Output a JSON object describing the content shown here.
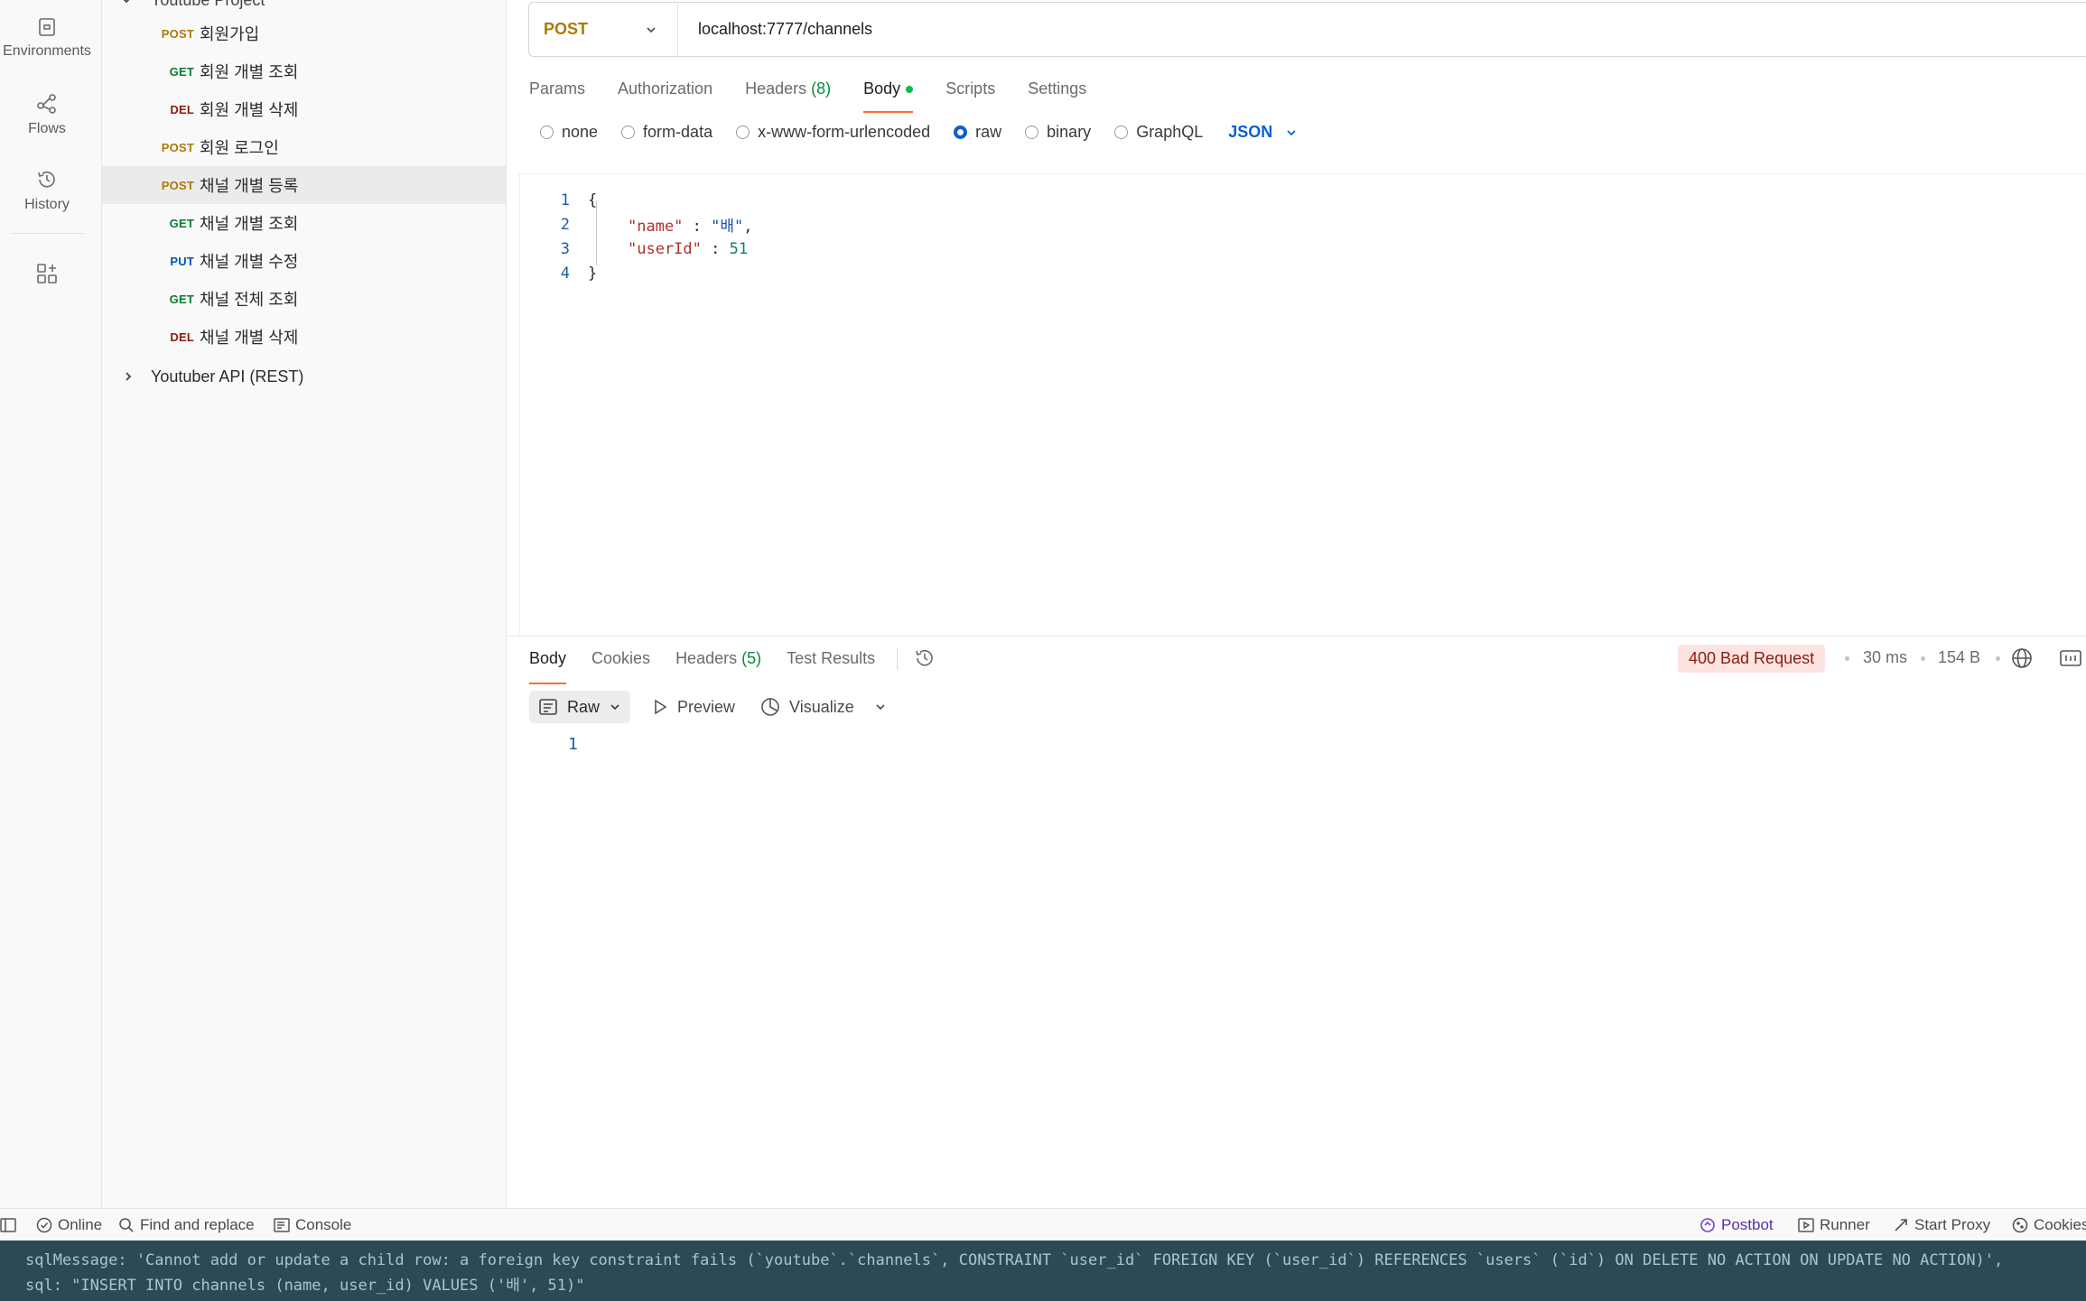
{
  "rail": {
    "items": [
      {
        "label": "Environments",
        "icon": "environments-icon"
      },
      {
        "label": "Flows",
        "icon": "flows-icon"
      },
      {
        "label": "History",
        "icon": "history-icon"
      }
    ]
  },
  "tree": {
    "parent_collection": "Youtube Project",
    "requests": [
      {
        "method": "POST",
        "name": "회원가입"
      },
      {
        "method": "GET",
        "name": "회원 개별 조회"
      },
      {
        "method": "DEL",
        "name": "회원 개별 삭제"
      },
      {
        "method": "POST",
        "name": "회원 로그인"
      },
      {
        "method": "POST",
        "name": "채널 개별 등록",
        "selected": true
      },
      {
        "method": "GET",
        "name": "채널 개별 조회"
      },
      {
        "method": "PUT",
        "name": "채널 개별 수정"
      },
      {
        "method": "GET",
        "name": "채널 전체 조회"
      },
      {
        "method": "DEL",
        "name": "채널 개별 삭제"
      }
    ],
    "collapsed_collection": "Youtuber API (REST)"
  },
  "request": {
    "method": "POST",
    "url": "localhost:7777/channels",
    "tabs": {
      "params": "Params",
      "authorization": "Authorization",
      "headers": "Headers",
      "headers_count": "(8)",
      "body": "Body",
      "scripts": "Scripts",
      "settings": "Settings"
    },
    "body_types": [
      "none",
      "form-data",
      "x-www-form-urlencoded",
      "raw",
      "binary",
      "GraphQL"
    ],
    "body_type_selected": "raw",
    "language": "JSON",
    "code_lines": {
      "l1": "1",
      "l2": "2",
      "l3": "3",
      "l4": "4",
      "open": "{",
      "key1": "\"name\"",
      "val1": "\"배\"",
      "key2": "\"userId\"",
      "val2": "51",
      "close": "}"
    }
  },
  "response": {
    "tabs": {
      "body": "Body",
      "cookies": "Cookies",
      "headers": "Headers",
      "headers_count": "(5)",
      "test_results": "Test Results"
    },
    "status": "400 Bad Request",
    "time": "30 ms",
    "size": "154 B",
    "format": "Raw",
    "preview": "Preview",
    "visualize": "Visualize",
    "line1": "1"
  },
  "statusbar": {
    "online": "Online",
    "find_replace": "Find and replace",
    "console": "Console",
    "postbot": "Postbot",
    "runner": "Runner",
    "start_proxy": "Start Proxy",
    "cookies": "Cookies"
  },
  "terminal": {
    "line1": "sqlMessage: 'Cannot add or update a child row: a foreign key constraint fails (`youtube`.`channels`, CONSTRAINT `user_id` FOREIGN KEY (`user_id`) REFERENCES `users` (`id`) ON DELETE NO ACTION ON UPDATE NO ACTION)',",
    "line2": "sql: \"INSERT INTO channels (name, user_id) VALUES ('배', 51)\""
  },
  "colors": {
    "accent": "#ff6c37",
    "post": "#ad7a03",
    "get": "#007f31",
    "del": "#8e1a10",
    "put": "#0053b8",
    "error_badge_bg": "#fde4e0"
  }
}
